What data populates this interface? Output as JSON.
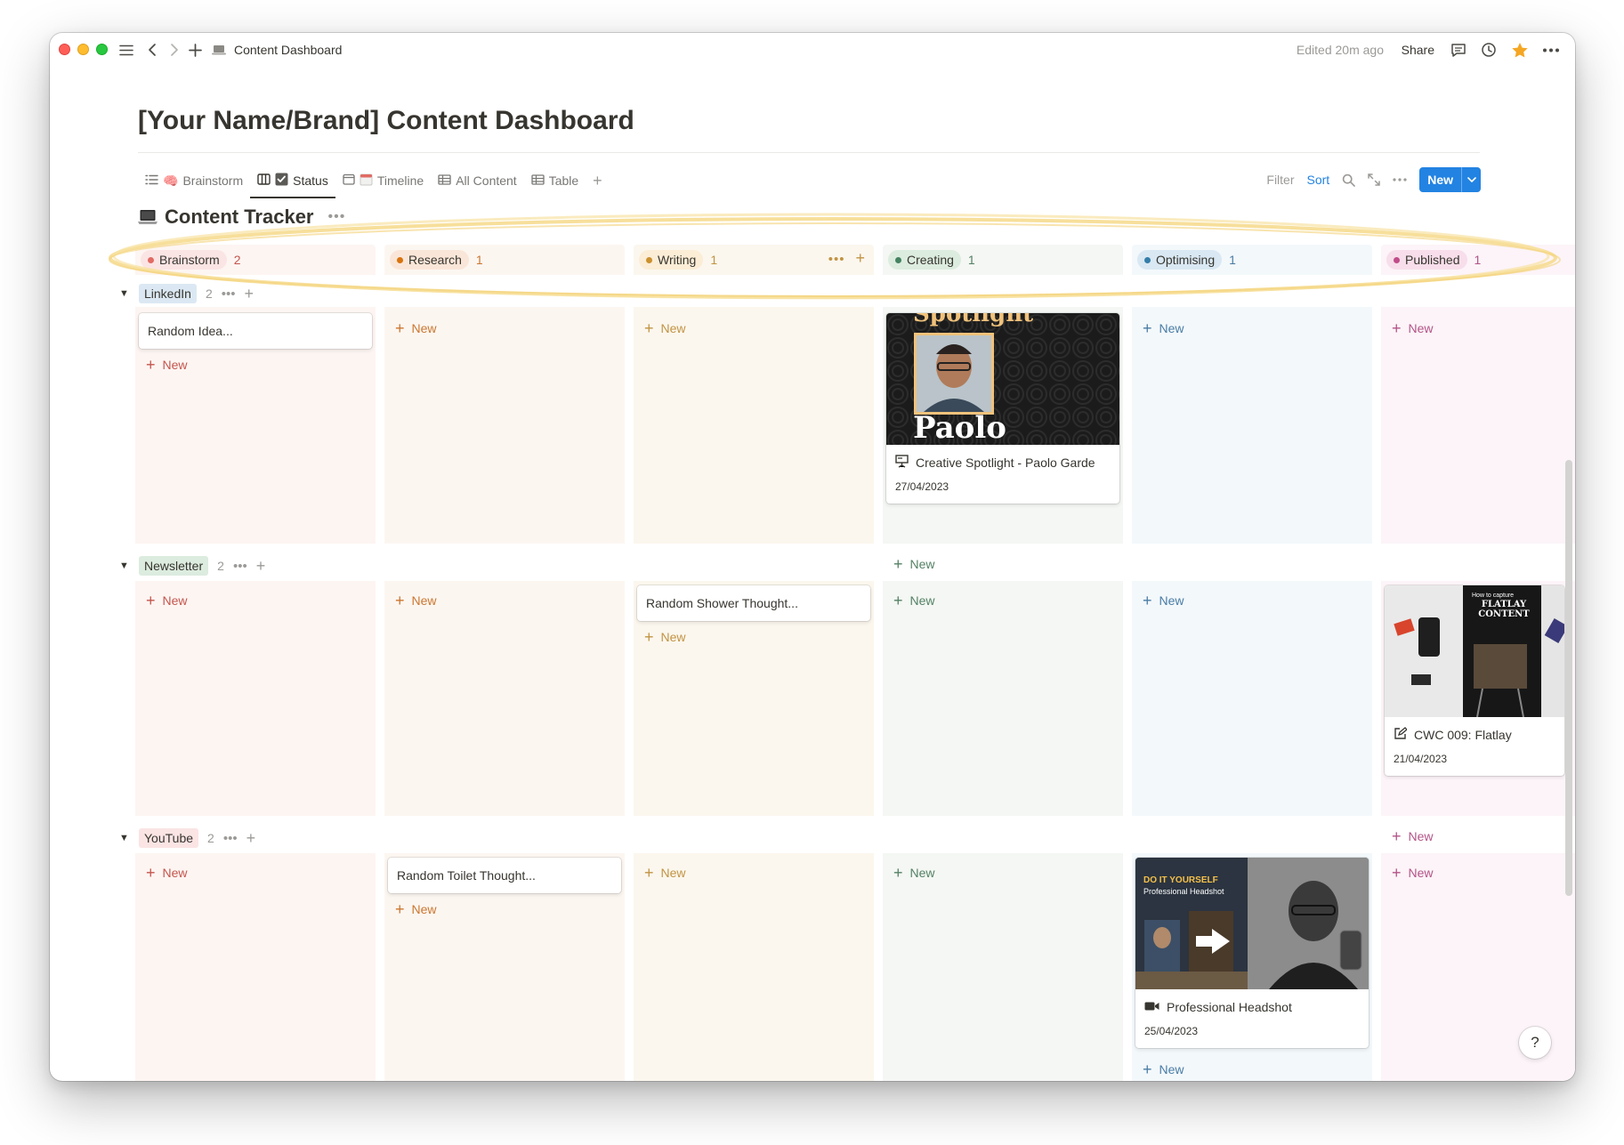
{
  "window": {
    "breadcrumb": "Content Dashboard",
    "edited": "Edited 20m ago",
    "share": "Share"
  },
  "page": {
    "title": "[Your Name/Brand] Content Dashboard"
  },
  "tabs": [
    {
      "label": "Brainstorm",
      "emoji": "🧠"
    },
    {
      "label": "Status",
      "emoji": "☑"
    },
    {
      "label": "Timeline",
      "emoji": "📆"
    },
    {
      "label": "All Content",
      "emoji": ""
    },
    {
      "label": "Table",
      "emoji": ""
    }
  ],
  "toolbar": {
    "filter": "Filter",
    "sort": "Sort",
    "new": "New"
  },
  "database": {
    "title": "Content Tracker",
    "icon": "laptop-icon"
  },
  "columns": [
    {
      "label": "Brainstorm",
      "count": "2",
      "bg": "#fdf5f2",
      "pill": "#fbe4e4",
      "dot": "#e16b64",
      "text": "#c4554d"
    },
    {
      "label": "Research",
      "count": "1",
      "bg": "#fcf6f1",
      "pill": "#fae6d8",
      "dot": "#d9730d",
      "text": "#cc772f"
    },
    {
      "label": "Writing",
      "count": "1",
      "bg": "#fbf7ee",
      "pill": "#fbedd6",
      "dot": "#cb912f",
      "text": "#c29343"
    },
    {
      "label": "Creating",
      "count": "1",
      "bg": "#f4f7f3",
      "pill": "#dcecdf",
      "dot": "#448361",
      "text": "#548164"
    },
    {
      "label": "Optimising",
      "count": "1",
      "bg": "#f3f8fb",
      "pill": "#d9e8f3",
      "dot": "#337ea9",
      "text": "#487ca5"
    },
    {
      "label": "Published",
      "count": "1",
      "bg": "#fcf4f8",
      "pill": "#f7deea",
      "dot": "#c14c8a",
      "text": "#b35488"
    }
  ],
  "groups": [
    {
      "label": "LinkedIn",
      "count": "2",
      "tag": "#dbe8f3"
    },
    {
      "label": "Newsletter",
      "count": "2",
      "tag": "#dcecdf"
    },
    {
      "label": "YouTube",
      "count": "2",
      "tag": "#fbe4e4"
    }
  ],
  "new_label": "New",
  "cards": {
    "linkedin_idea": {
      "title": "Random Idea..."
    },
    "spotlight": {
      "title": "Creative Spotlight - Paolo Garde",
      "date": "27/04/2023",
      "cover_name": "Paolo",
      "cover_top": "Spotlight",
      "icon": "presentation-icon"
    },
    "shower": {
      "title": "Random Shower Thought..."
    },
    "flatlay": {
      "title": "CWC 009: Flatlay",
      "date": "21/04/2023",
      "cover_top": "How to capture",
      "cover_main": "FLATLAY CONTENT",
      "icon": "edit-icon"
    },
    "toilet": {
      "title": "Random Toilet Thought..."
    },
    "headshot": {
      "title": "Professional Headshot",
      "date": "25/04/2023",
      "cover_top": "DO IT YOURSELF",
      "cover_sub": "Professional Headshot",
      "icon": "video-camera-icon"
    }
  },
  "help": "?"
}
